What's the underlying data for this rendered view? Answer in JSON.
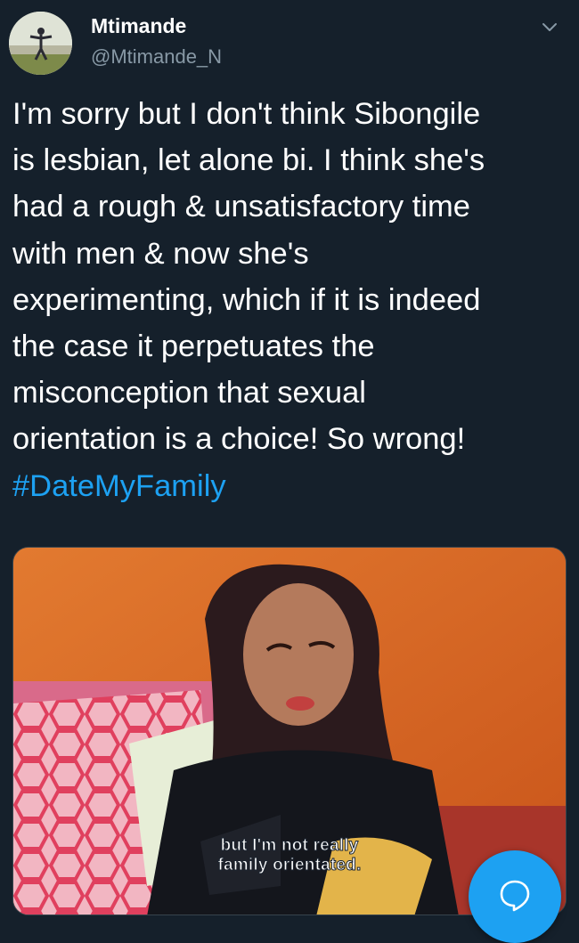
{
  "author": {
    "display_name": "Mtimande",
    "handle": "@Mtimande_N",
    "avatar": "profile-photo"
  },
  "tweet": {
    "text_lines": [
      "I'm sorry but I don't think Sibongile",
      "is lesbian, let alone bi. I think she's",
      "had a rough & unsatisfactory time",
      "with men & now she's",
      "experimenting, which if it is indeed",
      "the case it perpetuates the",
      "misconception that sexual",
      "orientation is a choice! So wrong!"
    ],
    "hashtag": "#DateMyFamily"
  },
  "media": {
    "subtitle_line1": "but I'm not really",
    "subtitle_line2": "family orientated."
  },
  "icons": {
    "menu": "chevron-down-icon",
    "compose": "speech-bubble-icon"
  },
  "colors": {
    "background": "#15202b",
    "text": "#ffffff",
    "secondary_text": "#8899a6",
    "accent": "#1da1f2"
  }
}
